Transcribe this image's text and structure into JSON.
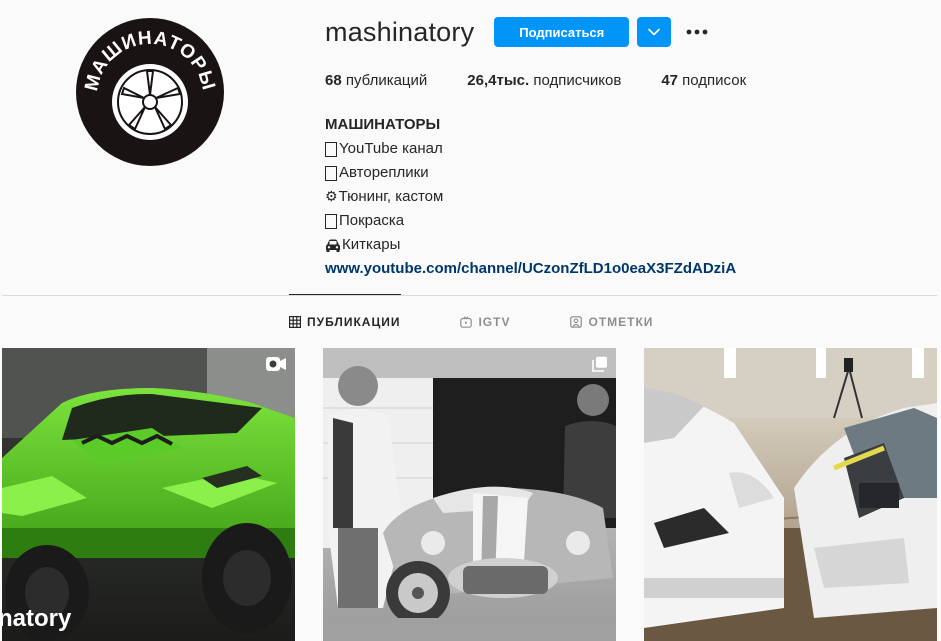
{
  "profile": {
    "username": "mashinatory",
    "follow_label": "Подписаться",
    "avatar_logo_text": "МАШИНАТОРЫ"
  },
  "stats": {
    "posts_count": "68",
    "posts_label": "публикаций",
    "followers_count": "26,4тыс.",
    "followers_label": "подписчиков",
    "following_count": "47",
    "following_label": "подписок"
  },
  "bio": {
    "name": "МАШИНАТОРЫ",
    "lines": [
      {
        "text": "YouTube канал",
        "icon": "unsupported-emoji-glyph"
      },
      {
        "text": "Автореплики",
        "icon": "unsupported-emoji-glyph"
      },
      {
        "text": "Тюнинг, кастом",
        "icon": "gear-emoji"
      },
      {
        "text": "Покраска",
        "icon": "unsupported-emoji-glyph"
      },
      {
        "text": "Киткары",
        "icon": "car-emoji"
      }
    ],
    "gear_glyph": "⚙",
    "link": "www.youtube.com/channel/UCzonZfLD1o0eaX3FZdADziA"
  },
  "tabs": [
    {
      "label": "ПУБЛИКАЦИИ",
      "icon": "grid-icon",
      "active": true
    },
    {
      "label": "IGTV",
      "icon": "igtv-icon",
      "active": false
    },
    {
      "label": "ОТМЕТКИ",
      "icon": "tagged-icon",
      "active": false
    }
  ],
  "posts": [
    {
      "badge": "video-icon",
      "watermark": "natory",
      "subject": "green-offroad-lamborghini"
    },
    {
      "badge": "carousel-icon",
      "subject": "two-men-with-shelby-cobra-replica"
    },
    {
      "badge": "none",
      "subject": "white-lamborghini-body-in-paint-booth"
    }
  ],
  "colors": {
    "accent": "#0095f6",
    "link": "#00376b",
    "background": "#fafafa",
    "border": "#dbdbdb",
    "muted": "#8e8e8e"
  }
}
